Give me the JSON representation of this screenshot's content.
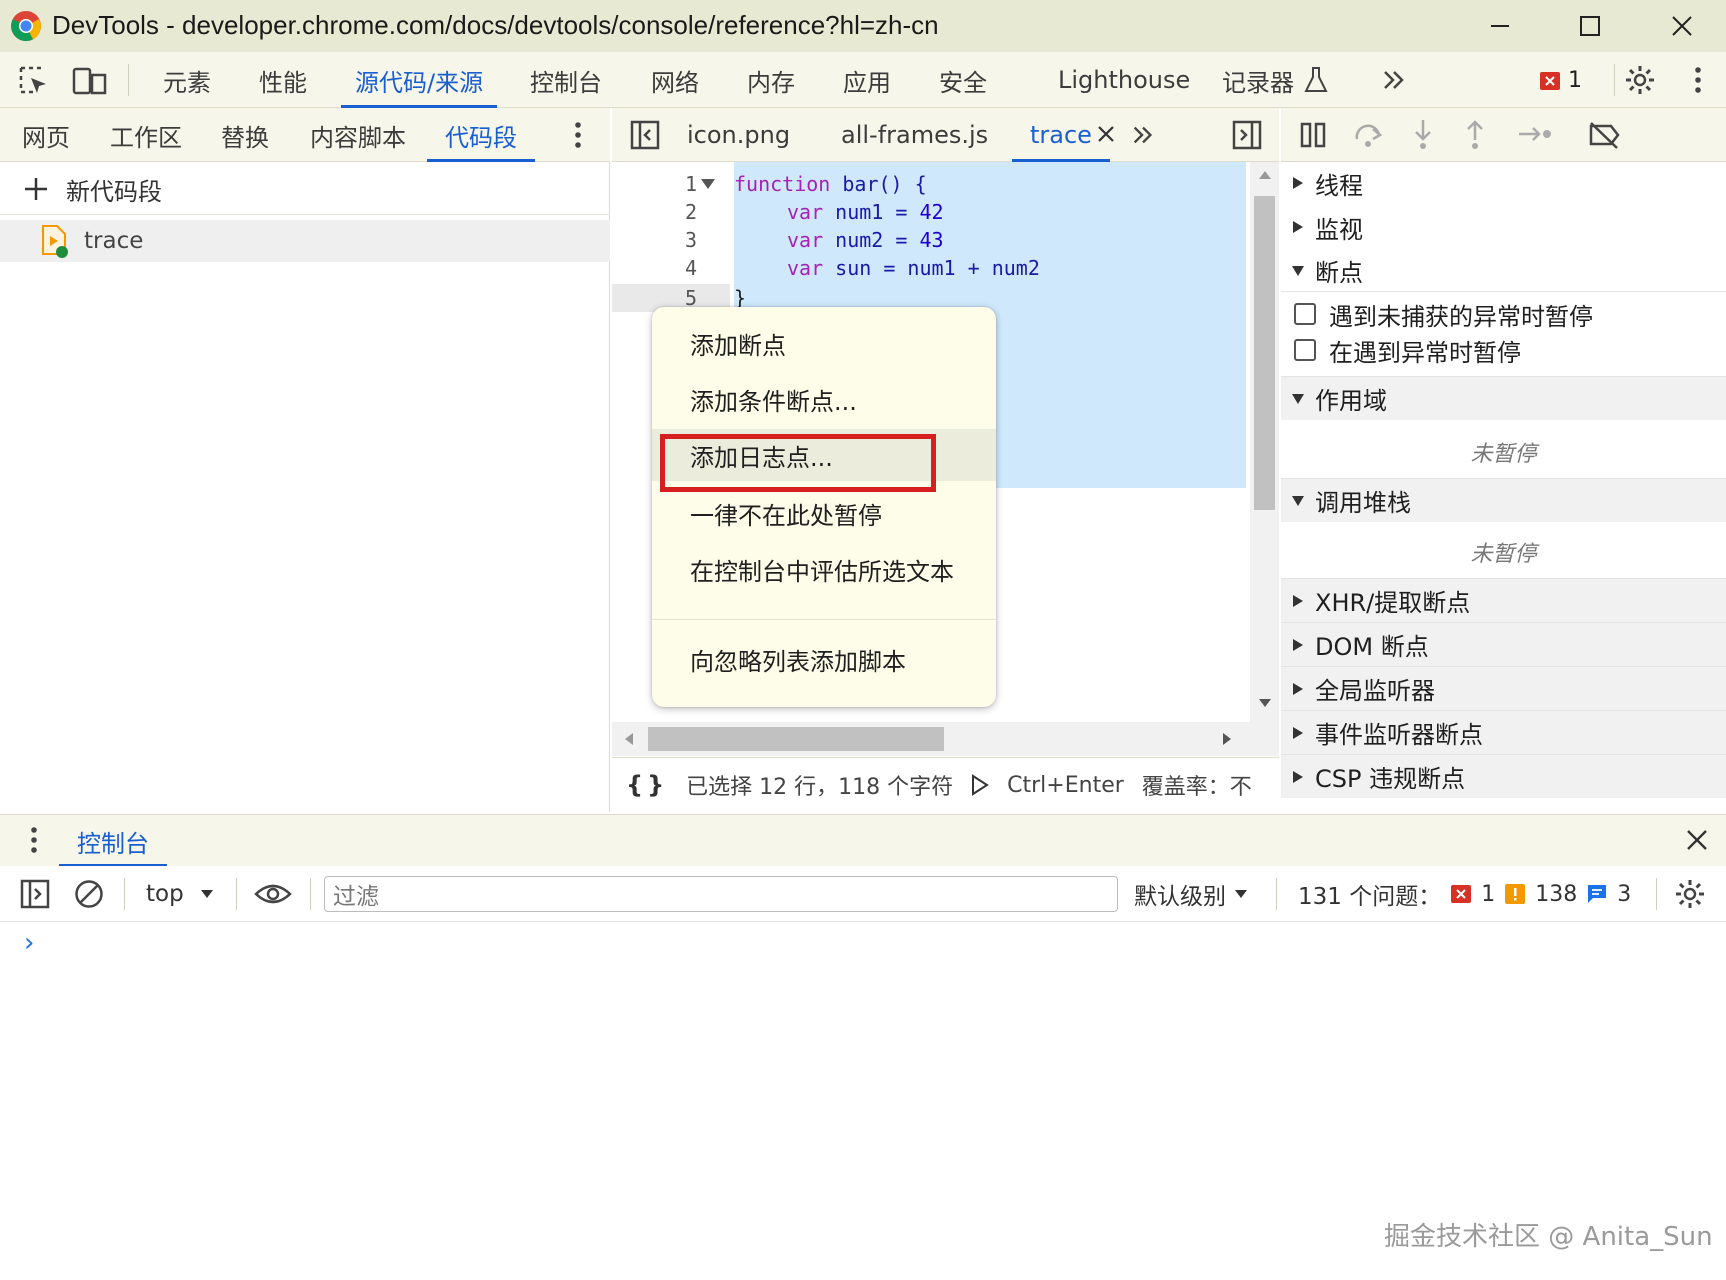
{
  "titlebar": {
    "title": "DevTools - developer.chrome.com/docs/devtools/console/reference?hl=zh-cn"
  },
  "main_tabs": [
    "元素",
    "性能",
    "源代码/来源",
    "控制台",
    "网络",
    "内存",
    "应用",
    "安全",
    "Lighthouse",
    "记录器"
  ],
  "main_active_tab": "源代码/来源",
  "error_count": "1",
  "sources_tabs": [
    "网页",
    "工作区",
    "替换",
    "内容脚本",
    "代码段"
  ],
  "sources_active_tab": "代码段",
  "navigator": {
    "new_snippet": "新代码段",
    "snippet_name": "trace"
  },
  "editor_tabs": [
    "icon.png",
    "all-frames.js",
    "trace"
  ],
  "editor_active_tab": "trace",
  "code": {
    "line_numbers": [
      "1",
      "2",
      "3",
      "4",
      "5"
    ],
    "line1_kw": "function",
    "line1_rest": " bar() {",
    "line2_kw": "var",
    "line2_id": " num1 = ",
    "line2_num": "42",
    "line3_kw": "var",
    "line3_id": " num2 = ",
    "line3_num": "43",
    "line4_kw": "var",
    "line4_id": " sun = num1 + num2",
    "line5": "}"
  },
  "context_menu": {
    "items": [
      "添加断点",
      "添加条件断点...",
      "添加日志点...",
      "一律不在此处暂停",
      "在控制台中评估所选文本",
      "向忽略列表添加脚本"
    ],
    "highlighted": "添加日志点..."
  },
  "status_bar": {
    "selection": "已选择 12 行，118 个字符",
    "run_shortcut": "Ctrl+Enter",
    "coverage": "覆盖率：不"
  },
  "debugger": {
    "threads": "线程",
    "watch": "监视",
    "breakpoints": "断点",
    "pause_uncaught": "遇到未捕获的异常时暂停",
    "pause_caught": "在遇到异常时暂停",
    "scope": "作用域",
    "scope_note": "未暂停",
    "call_stack": "调用堆栈",
    "call_stack_note": "未暂停",
    "xhr": "XHR/提取断点",
    "dom": "DOM 断点",
    "global": "全局监听器",
    "event": "事件监听器断点",
    "csp": "CSP 违规断点"
  },
  "drawer": {
    "tab": "控制台",
    "context": "top",
    "filter_placeholder": "过滤",
    "level": "默认级别",
    "issues_label": "131 个问题：",
    "issues_errors": "1",
    "issues_warnings": "138",
    "issues_info": "3",
    "prompt": "›"
  },
  "watermark": "掘金技术社区 @ Anita_Sun",
  "colors": {
    "accent": "#1a5fd0",
    "highlight_box": "#d61f1f",
    "selection": "#cfe8fc",
    "menu_bg": "#fdfde9"
  }
}
